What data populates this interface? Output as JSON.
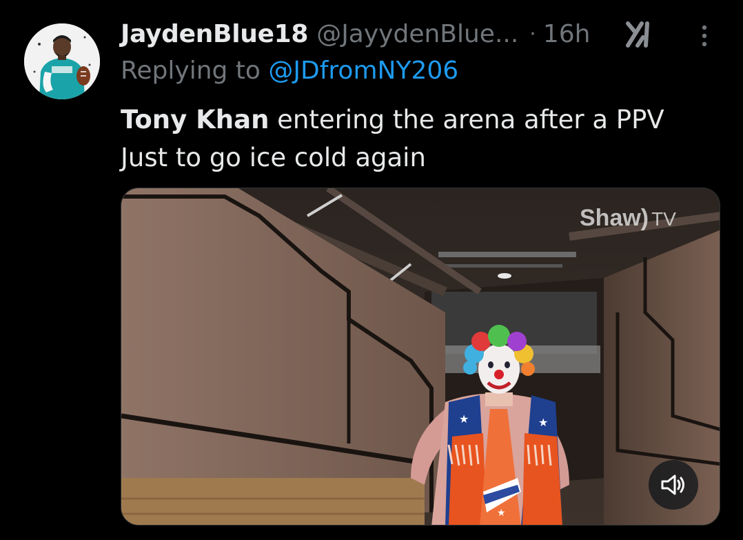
{
  "tweet": {
    "display_name": "JaydenBlue18",
    "handle": "@JayydenBlue...",
    "separator": "·",
    "time": "16h",
    "replying_prefix": "Replying to ",
    "replying_handle": "@JDfromNY206",
    "text_bold": "Tony Khan",
    "text_line1_rest": " entering the arena after a PPV",
    "text_line2": "Just to go ice cold again"
  },
  "media": {
    "type": "video",
    "watermark_brand": "Shaw)",
    "watermark_suffix": "TV",
    "audio_state": "muted"
  },
  "icons": {
    "avatar": "avatar-image",
    "grok": "grok-icon",
    "more": "more-options-icon",
    "mute": "speaker-muted-icon"
  },
  "colors": {
    "background": "#000000",
    "primary_text": "#e7e9ea",
    "secondary_text": "#71767b",
    "link": "#1d9bf0"
  }
}
